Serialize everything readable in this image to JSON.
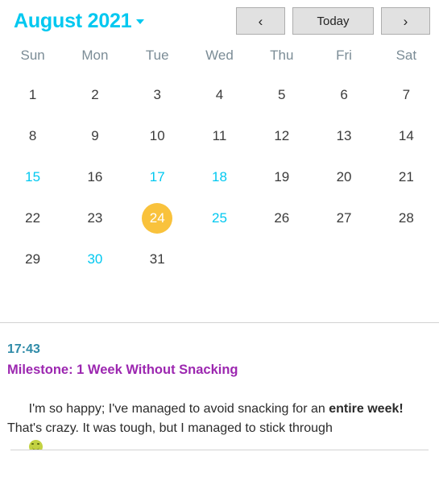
{
  "header": {
    "month_title": "August 2021",
    "dropdown_icon": "chevron-down-icon",
    "prev_label": "‹",
    "today_label": "Today",
    "next_label": "›",
    "accent_color": "#00c8f0"
  },
  "calendar": {
    "weekdays": [
      "Sun",
      "Mon",
      "Tue",
      "Wed",
      "Thu",
      "Fri",
      "Sat"
    ],
    "selected_day": 24,
    "selected_color": "#f9c23c",
    "entry_day_color": "#00c8f0",
    "days_with_entries": [
      15,
      17,
      18,
      25,
      30
    ],
    "weeks": [
      [
        {
          "label": "1"
        },
        {
          "label": "2"
        },
        {
          "label": "3"
        },
        {
          "label": "4"
        },
        {
          "label": "5"
        },
        {
          "label": "6"
        },
        {
          "label": "7"
        }
      ],
      [
        {
          "label": "8"
        },
        {
          "label": "9"
        },
        {
          "label": "10"
        },
        {
          "label": "11"
        },
        {
          "label": "12"
        },
        {
          "label": "13"
        },
        {
          "label": "14"
        }
      ],
      [
        {
          "label": "15"
        },
        {
          "label": "16"
        },
        {
          "label": "17"
        },
        {
          "label": "18"
        },
        {
          "label": "19"
        },
        {
          "label": "20"
        },
        {
          "label": "21"
        }
      ],
      [
        {
          "label": "22"
        },
        {
          "label": "23"
        },
        {
          "label": "24"
        },
        {
          "label": "25"
        },
        {
          "label": "26"
        },
        {
          "label": "27"
        },
        {
          "label": "28"
        }
      ],
      [
        {
          "label": "29"
        },
        {
          "label": "30"
        },
        {
          "label": "31"
        },
        {
          "label": ""
        },
        {
          "label": ""
        },
        {
          "label": ""
        },
        {
          "label": ""
        }
      ]
    ]
  },
  "entry": {
    "time": "17:43",
    "time_color": "#2f8ba8",
    "title": "Milestone: 1 Week Without Snacking",
    "title_color": "#9c27b0",
    "body_part1": "I'm so happy; I've managed to avoid snacking for an ",
    "body_bold1": "entire week!",
    "body_part2": " That's crazy. It was tough, but I managed to stick through",
    "emoji": "slightly-smiling-face"
  }
}
